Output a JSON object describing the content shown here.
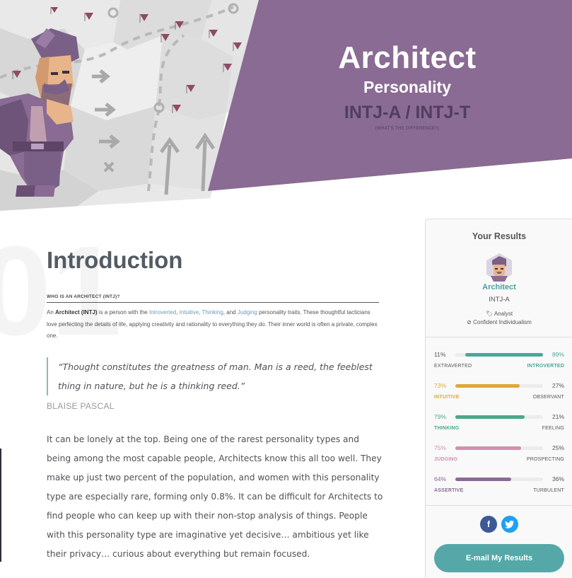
{
  "hero": {
    "title": "Architect",
    "subtitle": "Personality",
    "codes": "INTJ-A / INTJ-T",
    "difference_link": "(WHAT'S THE DIFFERENCE?)",
    "colors": {
      "banner": "#8a6b93",
      "code_text": "#4f3e5e"
    }
  },
  "main": {
    "section_number": "01",
    "title": "Introduction",
    "subheading": "WHO IS AN ARCHITECT (INTJ)?",
    "intro": {
      "p1": "An ",
      "name": "Architect (INTJ)",
      "p2": " is a person with the ",
      "t1": "Introverted",
      "sep1": ", ",
      "t2": "Intuitive",
      "sep2": ", ",
      "t3": "Thinking",
      "sep3": ", and ",
      "t4": "Judging",
      "p3": " personality traits. These thoughtful tacticians love perfecting the details of life, applying creativity and rationality to everything they do. Their inner world is often a private, complex one."
    },
    "quote": "“Thought constitutes the greatness of man. Man is a reed, the feeblest thing in nature, but he is a thinking reed.”",
    "quote_author": "BLAISE PASCAL",
    "body": "It can be lonely at the top. Being one of the rarest personality types and being among the most capable people, Architects know this all too well. They make up just two percent of the population, and women with this personality type are especially rare, forming only 0.8%. It can be difficult for Architects to find people who can keep up with their non-stop analysis of things. People with this personality type are imaginative yet decisive… ambitious yet like their privacy… curious about everything but remain focused."
  },
  "results": {
    "title": "Your Results",
    "name": "Architect",
    "code": "INTJ-A",
    "role": "Analyst",
    "strategy": "Confident Individualism",
    "role_icon": "tag-icon",
    "strategy_icon": "compass-icon",
    "traits": [
      {
        "left_pct": "11%",
        "right_pct": "89%",
        "left_label": "EXTRAVERTED",
        "right_label": "INTROVERTED",
        "value": 0.89,
        "side": "right",
        "color": "#4ba79a"
      },
      {
        "left_pct": "73%",
        "right_pct": "27%",
        "left_label": "INTUITIVE",
        "right_label": "OBSERVANT",
        "value": 0.73,
        "side": "left",
        "color": "#e0a73b"
      },
      {
        "left_pct": "79%",
        "right_pct": "21%",
        "left_label": "THINKING",
        "right_label": "FEELING",
        "value": 0.79,
        "side": "left",
        "color": "#4aa88a"
      },
      {
        "left_pct": "75%",
        "right_pct": "25%",
        "left_label": "JUDGING",
        "right_label": "PROSPECTING",
        "value": 0.75,
        "side": "left",
        "color": "#d28fb0"
      },
      {
        "left_pct": "64%",
        "right_pct": "36%",
        "left_label": "ASSERTIVE",
        "right_label": "TURBULENT",
        "value": 0.64,
        "side": "left",
        "color": "#8a6b93"
      }
    ],
    "facebook_icon": "f",
    "twitter_icon": "twitter-bird",
    "email_button": "E-mail My Results"
  }
}
